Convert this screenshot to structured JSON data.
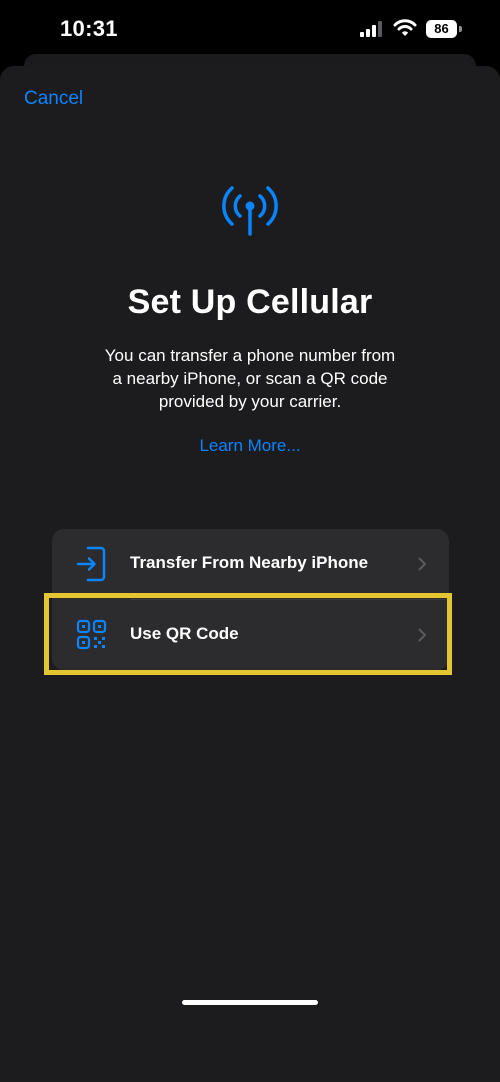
{
  "status_bar": {
    "time": "10:31",
    "battery": "86",
    "icons": [
      "cellular-signal-icon",
      "wifi-icon",
      "battery-icon"
    ]
  },
  "nav": {
    "cancel_label": "Cancel"
  },
  "hero": {
    "icon": "antenna-icon",
    "title": "Set Up Cellular",
    "description": "You can transfer a phone number from a nearby iPhone, or scan a QR code provided by your carrier.",
    "learn_more": "Learn More..."
  },
  "options": [
    {
      "label": "Transfer From Nearby iPhone",
      "icon": "transfer-in-icon"
    },
    {
      "label": "Use QR Code",
      "icon": "qr-code-icon"
    }
  ],
  "colors": {
    "accent": "#0a84ff",
    "sheet_background": "#1c1c1e",
    "row_background": "#2c2c2e",
    "highlight": "#e6c532"
  }
}
